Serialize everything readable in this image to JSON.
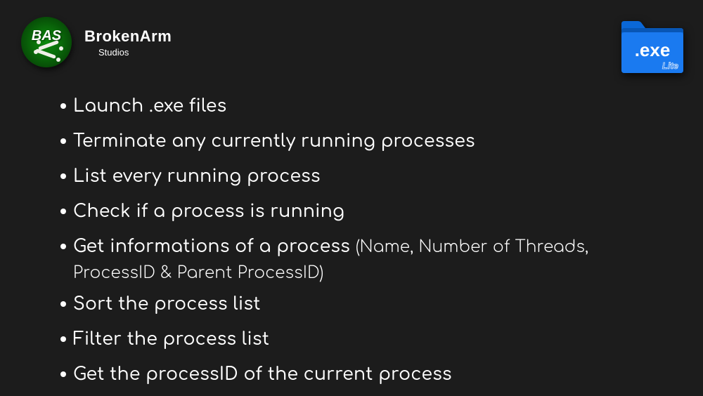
{
  "brand": {
    "logo_label": "BAS",
    "name": "BrokenArm",
    "subtitle": "Studios"
  },
  "exe_icon": {
    "label": ".exe",
    "badge": "Lite"
  },
  "features": [
    {
      "text": "Launch .exe files"
    },
    {
      "text": "Terminate any currently running processes"
    },
    {
      "text": "List every running process"
    },
    {
      "text": "Check if a process is running"
    },
    {
      "text": "Get informations of a process",
      "detail": "(Name, Number of Threads,",
      "continued": "ProcessID & Parent ProcessID)"
    },
    {
      "text": "Sort the process list"
    },
    {
      "text": "Filter the process list"
    },
    {
      "text": "Get the processID of the current process"
    }
  ]
}
